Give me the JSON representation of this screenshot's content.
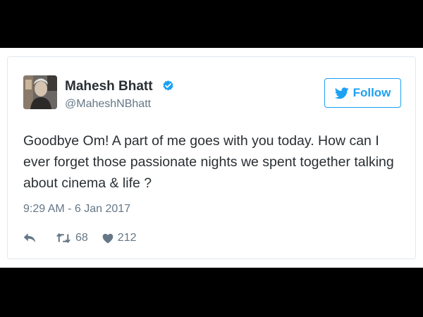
{
  "tweet": {
    "author": {
      "name": "Mahesh Bhatt",
      "handle": "@MaheshNBhatt"
    },
    "follow_label": "Follow",
    "text": "Goodbye Om! A part of me goes with you today. How can I ever forget those passionate nights we spent together talking about cinema & life ?",
    "timestamp": "9:29 AM - 6 Jan 2017",
    "retweets": "68",
    "likes": "212"
  },
  "icons": {
    "avatar": "person-photo",
    "verified": "verified-badge-icon",
    "follow": "bird-icon",
    "reply": "reply-icon",
    "retweet": "retweet-icon",
    "like": "heart-icon"
  },
  "colors": {
    "accent": "#1da1f2",
    "text": "#292f33",
    "secondary": "#657786",
    "border": "#e1e8ed",
    "letterbox": "#000000"
  }
}
